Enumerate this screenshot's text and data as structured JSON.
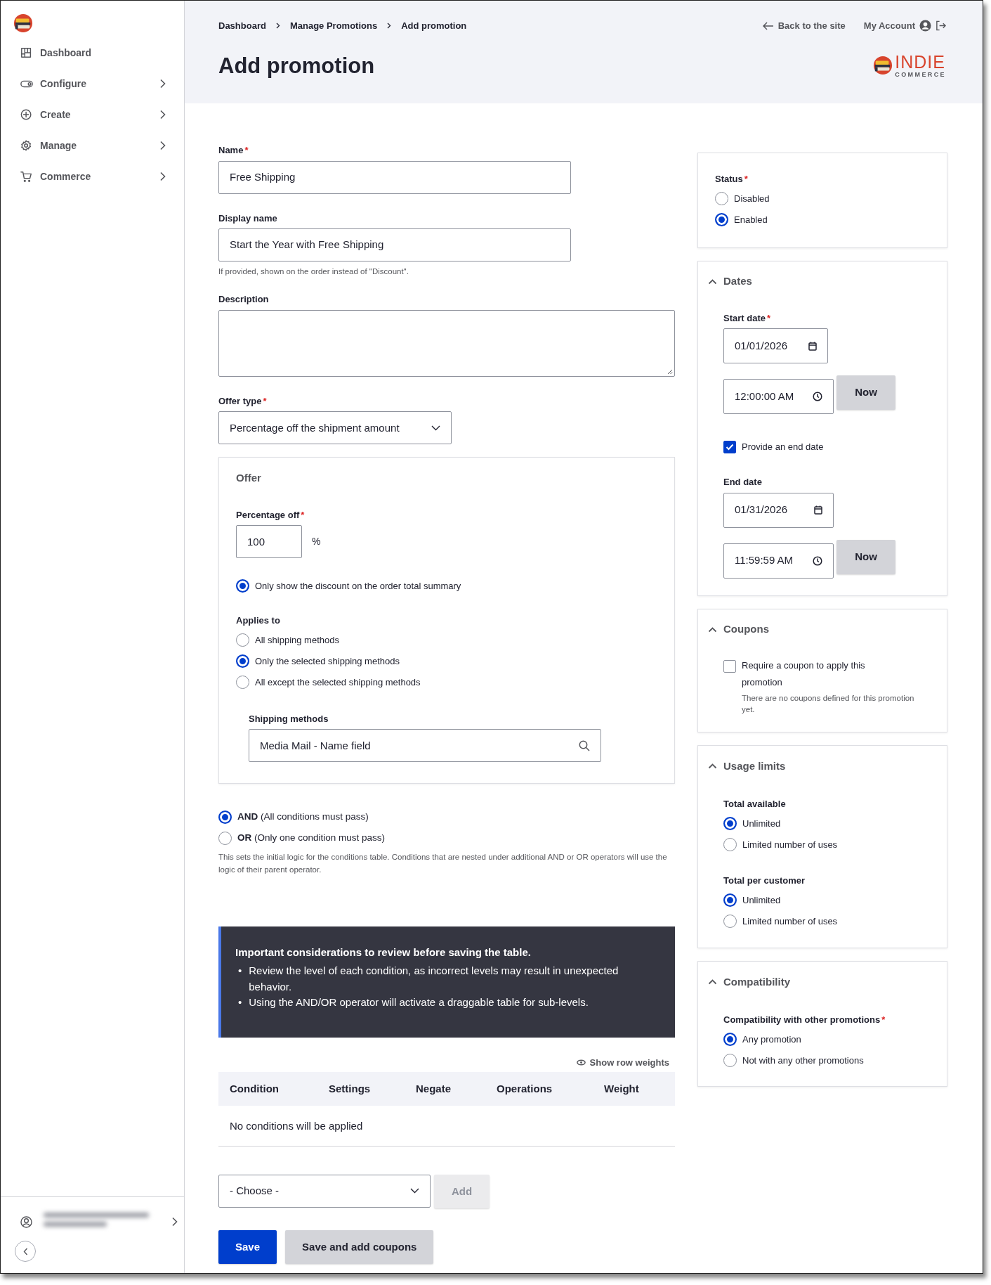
{
  "sidebar": {
    "items": [
      {
        "label": "Dashboard",
        "kind": "dashboard",
        "expandable": false
      },
      {
        "label": "Configure",
        "kind": "toggle",
        "expandable": true
      },
      {
        "label": "Create",
        "kind": "plus",
        "expandable": true
      },
      {
        "label": "Manage",
        "kind": "gear",
        "expandable": true
      },
      {
        "label": "Commerce",
        "kind": "cart",
        "expandable": true
      }
    ],
    "user_menu": {
      "expandable": true
    }
  },
  "header": {
    "breadcrumbs": [
      "Dashboard",
      "Manage Promotions",
      "Add promotion"
    ],
    "title": "Add promotion",
    "back_link": "Back to the site",
    "account_link": "My Account",
    "logo": {
      "word": "INDIE",
      "tagline": "COMMERCE"
    }
  },
  "form": {
    "fields": [
      {
        "kind": "text",
        "label": "Name",
        "required_mark": "*",
        "value": "Free Shipping"
      },
      {
        "kind": "text",
        "label": "Display name",
        "value": "Start the Year with Free Shipping",
        "help": "If provided, shown on the order instead of \"Discount\"."
      },
      {
        "kind": "textarea",
        "label": "Description"
      },
      {
        "kind": "select",
        "label": "Offer type",
        "required_mark": "*",
        "value": "Percentage off the shipment amount"
      }
    ],
    "offer": {
      "title": "Offer",
      "percentage": {
        "label": "Percentage off",
        "required_mark": "*",
        "value": "100",
        "unit": "%"
      },
      "display_option": {
        "label": "Only show the discount on the order total summary",
        "selected": true
      },
      "applies_to": {
        "label": "Applies to",
        "options": [
          {
            "label": "All shipping methods",
            "selected": false
          },
          {
            "label": "Only the selected shipping methods",
            "selected": true
          },
          {
            "label": "All except the selected shipping methods",
            "selected": false
          }
        ]
      },
      "shipping_methods": {
        "label": "Shipping methods",
        "value": "Media Mail - Name field"
      }
    },
    "logic": {
      "options": [
        {
          "keyword": "AND",
          "label": "(All conditions must pass)",
          "selected": true
        },
        {
          "keyword": "OR",
          "label": "(Only one condition must pass)",
          "selected": false
        }
      ],
      "help": "This sets the initial logic for the conditions table. Conditions that are nested under additional AND or OR operators will use the logic of their parent operator."
    },
    "alert": {
      "title": "Important considerations to review before saving the table.",
      "items": [
        {
          "bullet": "•",
          "text": "Review the level of each condition, as incorrect levels may result in unexpected behavior."
        },
        {
          "bullet": "•",
          "text": "Using the AND/OR operator will activate a draggable table for sub-levels."
        }
      ]
    },
    "conditions": {
      "show_weights": "Show row weights",
      "columns": [
        "Condition",
        "Settings",
        "Negate",
        "Operations",
        "Weight"
      ],
      "empty": "No conditions will be applied",
      "choose": "- Choose -",
      "add_button": {
        "label": "Add",
        "disabled": true
      }
    },
    "actions": [
      {
        "label": "Save",
        "kind": "primary"
      },
      {
        "label": "Save and add coupons",
        "kind": "secondary"
      }
    ]
  },
  "side": {
    "status": {
      "label": "Status",
      "required_mark": "*",
      "options": [
        {
          "label": "Disabled",
          "selected": false
        },
        {
          "label": "Enabled",
          "selected": true
        }
      ]
    },
    "dates": {
      "title": "Dates",
      "expanded": true,
      "start": {
        "label": "Start date",
        "required_mark": "*",
        "date": "01/01/2026",
        "time": "12:00:00 AM",
        "now": "Now"
      },
      "end_toggle": {
        "label": "Provide an end date",
        "checked": true
      },
      "end": {
        "label": "End date",
        "date": "01/31/2026",
        "time": "11:59:59 AM",
        "now": "Now"
      }
    },
    "coupons": {
      "title": "Coupons",
      "expanded": true,
      "require": {
        "label": "Require a coupon to apply this promotion",
        "checked": false
      },
      "help": "There are no coupons defined for this promotion yet."
    },
    "usage": {
      "title": "Usage limits",
      "expanded": true,
      "groups": [
        {
          "label": "Total available",
          "options": [
            {
              "label": "Unlimited",
              "selected": true
            },
            {
              "label": "Limited number of uses",
              "selected": false
            }
          ]
        },
        {
          "label": "Total per customer",
          "options": [
            {
              "label": "Unlimited",
              "selected": true
            },
            {
              "label": "Limited number of uses",
              "selected": false
            }
          ]
        }
      ]
    },
    "compatibility": {
      "title": "Compatibility",
      "expanded": true,
      "label": "Compatibility with other promotions",
      "required_mark": "*",
      "options": [
        {
          "label": "Any promotion",
          "selected": true
        },
        {
          "label": "Not with any other promotions",
          "selected": false
        }
      ]
    }
  }
}
